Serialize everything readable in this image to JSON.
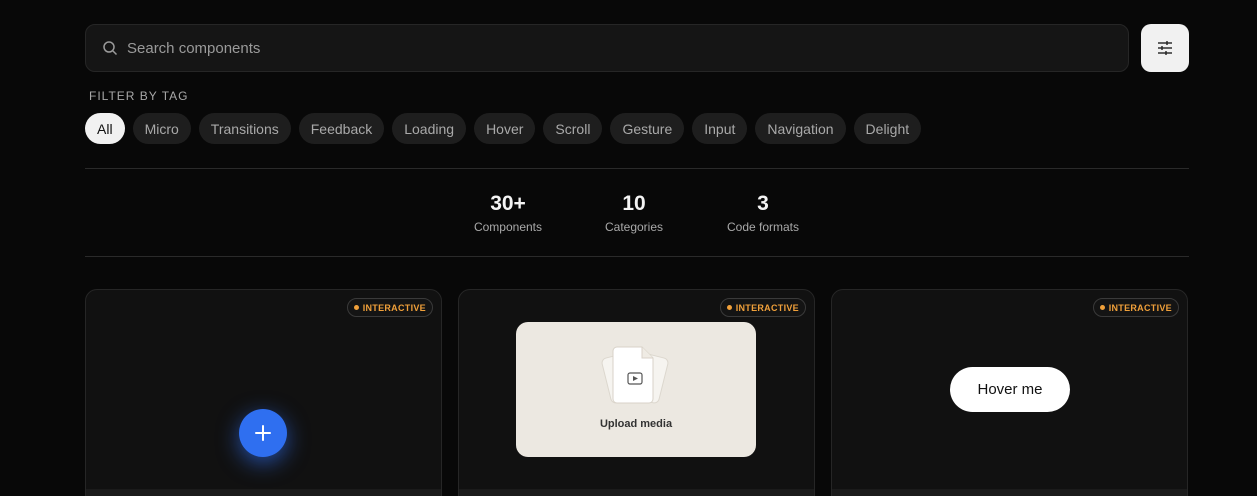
{
  "search": {
    "placeholder": "Search components"
  },
  "filter": {
    "label": "FILTER BY TAG",
    "tags": [
      "All",
      "Micro",
      "Transitions",
      "Feedback",
      "Loading",
      "Hover",
      "Scroll",
      "Gesture",
      "Input",
      "Navigation",
      "Delight"
    ],
    "active": "All"
  },
  "stats": [
    {
      "value": "30+",
      "label": "Components"
    },
    {
      "value": "10",
      "label": "Categories"
    },
    {
      "value": "3",
      "label": "Code formats"
    }
  ],
  "cards": [
    {
      "badge": "INTERACTIVE"
    },
    {
      "badge": "INTERACTIVE",
      "upload_label": "Upload media"
    },
    {
      "badge": "INTERACTIVE",
      "button_label": "Hover me"
    }
  ],
  "colors": {
    "accent_blue": "#2f6ff0",
    "badge_orange": "#f0a03a",
    "background": "#080808"
  },
  "icons": {
    "search": "search-icon",
    "filter": "sliders-icon",
    "plus": "plus-icon",
    "file": "video-file-icon"
  }
}
